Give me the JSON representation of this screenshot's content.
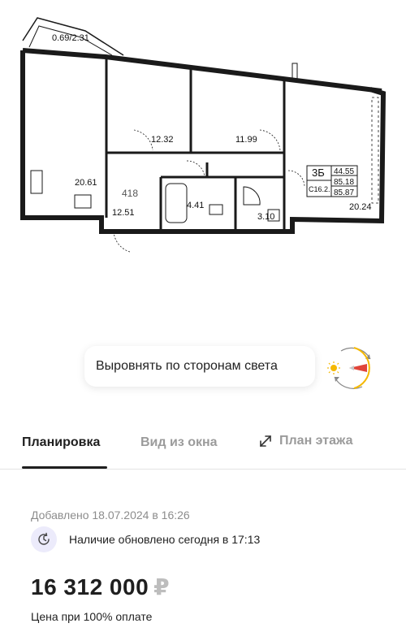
{
  "floorplan": {
    "balcony_label": "0.69/2.31",
    "rooms": {
      "living": "20.61",
      "bedroom1": "12.32",
      "bedroom2": "11.99",
      "hall_num": "418",
      "hall": "12.51",
      "bath": "4.41",
      "wc": "3.10",
      "kitchen": "20.24"
    },
    "spec": {
      "code": "3Б",
      "sub": "С16.2.",
      "a1": "44.55",
      "a2": "85.18",
      "a3": "85.87"
    }
  },
  "align": {
    "label": "Выровнять по сторонам света",
    "compass_icon": "compass-icon"
  },
  "tabs": [
    {
      "label": "Планировка",
      "active": true
    },
    {
      "label": "Вид из окна",
      "active": false
    },
    {
      "label": "План этажа",
      "active": false,
      "icon": "expand-icon"
    }
  ],
  "info": {
    "added": "Добавлено 18.07.2024 в 16:26",
    "availability": "Наличие обновлено сегодня в 17:13",
    "availability_icon": "clock-refresh-icon",
    "price": "16 312 000",
    "currency": "₽",
    "price_note": "Цена при 100% оплате"
  },
  "colors": {
    "accent_red": "#e0453a",
    "sun_yellow": "#f5b800",
    "icon_bg": "#ecebfb"
  }
}
